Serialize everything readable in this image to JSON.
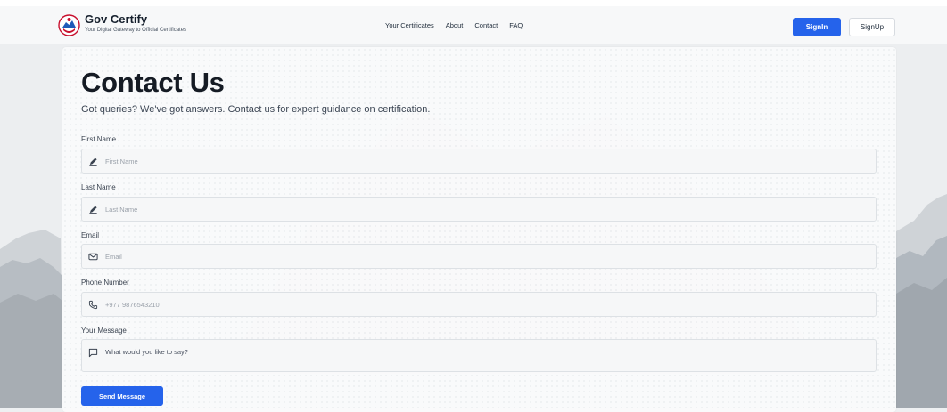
{
  "header": {
    "brand_title": "Gov Certify",
    "brand_subtitle": "Your Digital Gateway to Official Certificates",
    "nav": [
      {
        "label": "Your Certificates"
      },
      {
        "label": "About"
      },
      {
        "label": "Contact"
      },
      {
        "label": "FAQ"
      }
    ],
    "signin_label": "SignIn",
    "signup_label": "SignUp",
    "accent_color": "#2563eb"
  },
  "contact": {
    "title": "Contact Us",
    "subtitle": "Got queries? We've got answers. Contact us for expert guidance on certification.",
    "fields": {
      "first_name": {
        "label": "First Name",
        "placeholder": "First Name",
        "icon": "pencil-icon"
      },
      "last_name": {
        "label": "Last Name",
        "placeholder": "Last Name",
        "icon": "pencil-icon"
      },
      "email": {
        "label": "Email",
        "placeholder": "Email",
        "icon": "envelope-icon"
      },
      "phone": {
        "label": "Phone Number",
        "placeholder": "+977 9876543210",
        "icon": "phone-icon"
      },
      "message": {
        "label": "Your Message",
        "placeholder": "What would you like to say?",
        "icon": "chat-bubble-icon"
      }
    },
    "submit_label": "Send Message"
  }
}
